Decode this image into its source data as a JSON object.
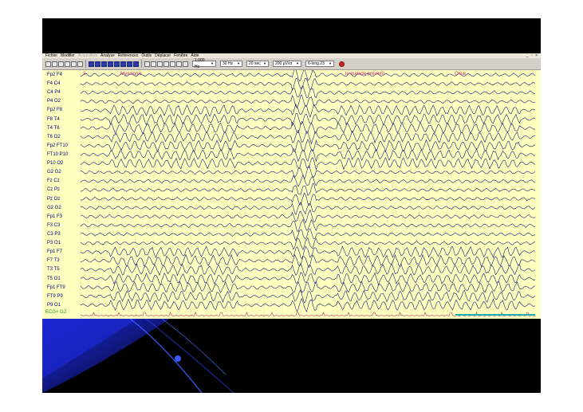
{
  "menu": {
    "items": [
      "Fichier",
      "Modifier",
      "Acquisition",
      "Analyse",
      "Références",
      "Outils",
      "Déplacer",
      "Fenêtre",
      "Aide"
    ],
    "window_controls": "_ ▫ ×"
  },
  "toolbar": {
    "sensitivity_combo": "1,000 Hz",
    "lowpass_combo": "30 Hz",
    "timebase_combo": "20 sec",
    "gain_combo": "200 µV/cr",
    "montage_combo": "6-long.23"
  },
  "channels": [
    "Fp2 F4",
    "F4 C4",
    "C4 P4",
    "P4 O2",
    "Fp2 F8",
    "F8 T4",
    "T4 T6",
    "T6 O2",
    "Fp2 FT10",
    "FT10 P10",
    "P10 O2",
    "G2 G2",
    "Fz Cz",
    "Cz Pz",
    "Pz Oz",
    "G2 G2",
    "Fp1 F3",
    "F3 C3",
    "C3 P3",
    "P3 O1",
    "Fp1 F7",
    "F7 T3",
    "T3 T5",
    "T5 O1",
    "Fp1 FT9",
    "FT9 P9",
    "P9 O1"
  ],
  "ecg_label": "ECG+ G2",
  "annotations": {
    "a1": "2",
    "a2": "Myoclonie",
    "a3": "le malade prévient",
    "a4": "Crise"
  },
  "colors": {
    "trace": "#1a1a7a",
    "background": "#ffffc0",
    "annotation": "#c8326e",
    "ecg": "#1a9a1a",
    "marker": "#1ab4b4"
  }
}
